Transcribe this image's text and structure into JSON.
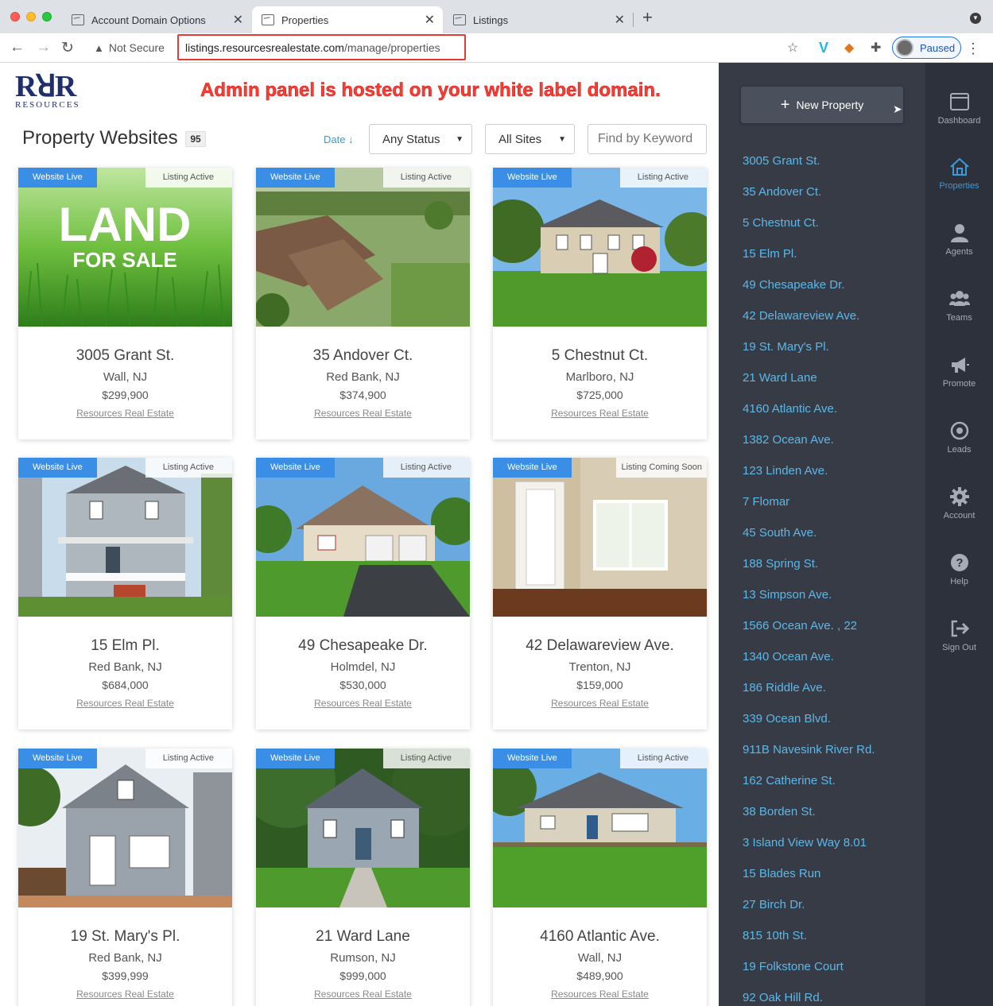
{
  "browser": {
    "tabs": [
      {
        "title": "Account Domain Options",
        "active": false
      },
      {
        "title": "Properties",
        "active": true
      },
      {
        "title": "Listings",
        "active": false
      }
    ],
    "security_label": "Not Secure",
    "url_host": "listings.resourcesrealestate.com",
    "url_path": "/manage/properties",
    "profile_label": "Paused"
  },
  "header": {
    "logo_mark": "RꓤR",
    "logo_word": "RESOURCES",
    "annotation": "Admin panel is hosted on your white label domain."
  },
  "toolbar": {
    "title": "Property Websites",
    "count": "95",
    "sort_label": "Date",
    "status_select": "Any Status",
    "sites_select": "All Sites",
    "keyword_placeholder": "Find by Keyword"
  },
  "cards": [
    {
      "address": "3005 Grant St.",
      "city": "Wall, NJ",
      "price": "$299,900",
      "site": "Resources Real Estate",
      "website_status": "Website Live",
      "listing_status": "Listing Active",
      "image": "land-for-sale",
      "image_text_1": "LAND",
      "image_text_2": "FOR SALE"
    },
    {
      "address": "35 Andover Ct.",
      "city": "Red Bank, NJ",
      "price": "$374,900",
      "site": "Resources Real Estate",
      "website_status": "Website Live",
      "listing_status": "Listing Active",
      "image": "aerial-house"
    },
    {
      "address": "5 Chestnut Ct.",
      "city": "Marlboro, NJ",
      "price": "$725,000",
      "site": "Resources Real Estate",
      "website_status": "Website Live",
      "listing_status": "Listing Active",
      "image": "colonial-house"
    },
    {
      "address": "15 Elm Pl.",
      "city": "Red Bank, NJ",
      "price": "$684,000",
      "site": "Resources Real Estate",
      "website_status": "Website Live",
      "listing_status": "Listing Active",
      "image": "porch-house"
    },
    {
      "address": "49 Chesapeake Dr.",
      "city": "Holmdel, NJ",
      "price": "$530,000",
      "site": "Resources Real Estate",
      "website_status": "Website Live",
      "listing_status": "Listing Active",
      "image": "ranch-garage-house"
    },
    {
      "address": "42 Delawareview Ave.",
      "city": "Trenton, NJ",
      "price": "$159,000",
      "site": "Resources Real Estate",
      "website_status": "Website Live",
      "listing_status": "Listing Coming Soon",
      "image": "interior-room"
    },
    {
      "address": "19 St. Mary's Pl.",
      "city": "Red Bank, NJ",
      "price": "$399,999",
      "site": "Resources Real Estate",
      "website_status": "Website Live",
      "listing_status": "Listing Active",
      "image": "white-cottage"
    },
    {
      "address": "21 Ward Lane",
      "city": "Rumson, NJ",
      "price": "$999,000",
      "site": "Resources Real Estate",
      "website_status": "Website Live",
      "listing_status": "Listing Active",
      "image": "gray-house"
    },
    {
      "address": "4160 Atlantic Ave.",
      "city": "Wall, NJ",
      "price": "$489,900",
      "site": "Resources Real Estate",
      "website_status": "Website Live",
      "listing_status": "Listing Active",
      "image": "ranch-lawn-house"
    }
  ],
  "property_list": {
    "new_button": "New Property",
    "items": [
      "3005 Grant St.",
      "35 Andover Ct.",
      "5 Chestnut Ct.",
      "15 Elm Pl.",
      "49 Chesapeake Dr.",
      "42 Delawareview Ave.",
      "19 St. Mary's Pl.",
      "21 Ward Lane",
      "4160 Atlantic Ave.",
      "1382 Ocean Ave.",
      "123 Linden Ave.",
      "7 Flomar",
      "45 South Ave.",
      "188 Spring St.",
      "13 Simpson Ave.",
      "1566 Ocean Ave. , 22",
      "1340 Ocean Ave.",
      "186 Riddle Ave.",
      "339 Ocean Blvd.",
      "911B Navesink River Rd.",
      "162 Catherine St.",
      "38 Borden St.",
      "3 Island View Way 8.01",
      "15 Blades Run",
      "27 Birch Dr.",
      "815 10th St.",
      "19 Folkstone Court",
      "92 Oak Hill Rd."
    ]
  },
  "nav": [
    {
      "label": "Dashboard",
      "icon": "dashboard-icon",
      "active": false
    },
    {
      "label": "Properties",
      "icon": "home-icon",
      "active": true
    },
    {
      "label": "Agents",
      "icon": "user-icon",
      "active": false
    },
    {
      "label": "Teams",
      "icon": "users-icon",
      "active": false
    },
    {
      "label": "Promote",
      "icon": "megaphone-icon",
      "active": false
    },
    {
      "label": "Leads",
      "icon": "target-icon",
      "active": false
    },
    {
      "label": "Account",
      "icon": "gear-icon",
      "active": false
    },
    {
      "label": "Help",
      "icon": "help-icon",
      "active": false
    },
    {
      "label": "Sign Out",
      "icon": "sign-out-icon",
      "active": false
    }
  ],
  "colors": {
    "accent": "#3b9ad9",
    "badge_live": "#3a8ee6",
    "panel_dark": "#363b46",
    "sidebar_dark": "#2c313b",
    "link": "#5cb8e8",
    "annotation_red": "#ff3b30"
  }
}
